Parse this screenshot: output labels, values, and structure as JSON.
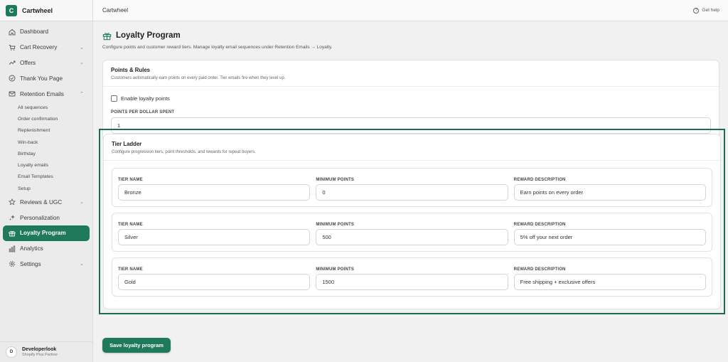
{
  "brand": {
    "logo_letter": "C",
    "name": "Cartwheel"
  },
  "nav": [
    {
      "label": "Dashboard",
      "icon": "home-icon",
      "chevron": ""
    },
    {
      "label": "Cart Recovery",
      "icon": "cart-icon",
      "chevron": "⌄"
    },
    {
      "label": "Offers",
      "icon": "trend-icon",
      "chevron": "⌄"
    },
    {
      "label": "Thank You Page",
      "icon": "check-circle-icon",
      "chevron": ""
    },
    {
      "label": "Retention Emails",
      "icon": "mail-icon",
      "chevron": "⌃"
    }
  ],
  "subnav": [
    "All sequences",
    "Order confirmation",
    "Replenishment",
    "Win-back",
    "Birthday",
    "Loyalty emails",
    "Email Templates",
    "Setup"
  ],
  "nav2": [
    {
      "label": "Reviews & UGC",
      "icon": "star-icon",
      "chevron": "⌄"
    },
    {
      "label": "Personalization",
      "icon": "sparkle-icon",
      "chevron": ""
    },
    {
      "label": "Loyalty Program",
      "icon": "gift-icon",
      "chevron": "",
      "active": true
    },
    {
      "label": "Analytics",
      "icon": "bar-chart-icon",
      "chevron": ""
    },
    {
      "label": "Settings",
      "icon": "gear-icon",
      "chevron": "⌄"
    }
  ],
  "user": {
    "initial": "D",
    "name": "Developerlook",
    "role": "Shopify Plus Partner"
  },
  "topbar": {
    "title": "Cartwheel",
    "help": "Get help"
  },
  "page": {
    "title": "Loyalty Program",
    "description": "Configure points and customer reward tiers. Manage loyalty email sequences under Retention Emails → Loyalty."
  },
  "points": {
    "title": "Points & Rules",
    "subtitle": "Customers automatically earn points on every paid order. Tier emails fire when they level up.",
    "enable_label": "Enable loyalty points",
    "ppd_label": "POINTS PER DOLLAR SPENT",
    "ppd_value": "1"
  },
  "tiers": {
    "title": "Tier Ladder",
    "subtitle": "Configure progression tiers, point thresholds, and rewards for repeat buyers.",
    "labels": {
      "name": "TIER NAME",
      "min": "MINIMUM POINTS",
      "reward": "REWARD DESCRIPTION"
    },
    "rows": [
      {
        "name": "Bronze",
        "min": "0",
        "reward": "Earn points on every order"
      },
      {
        "name": "Silver",
        "min": "500",
        "reward": "5% off your next order"
      },
      {
        "name": "Gold",
        "min": "1500",
        "reward": "Free shipping + exclusive offers"
      }
    ]
  },
  "save_label": "Save loyalty program",
  "colors": {
    "accent": "#1f7a5c",
    "focus": "#1f6b4d"
  }
}
